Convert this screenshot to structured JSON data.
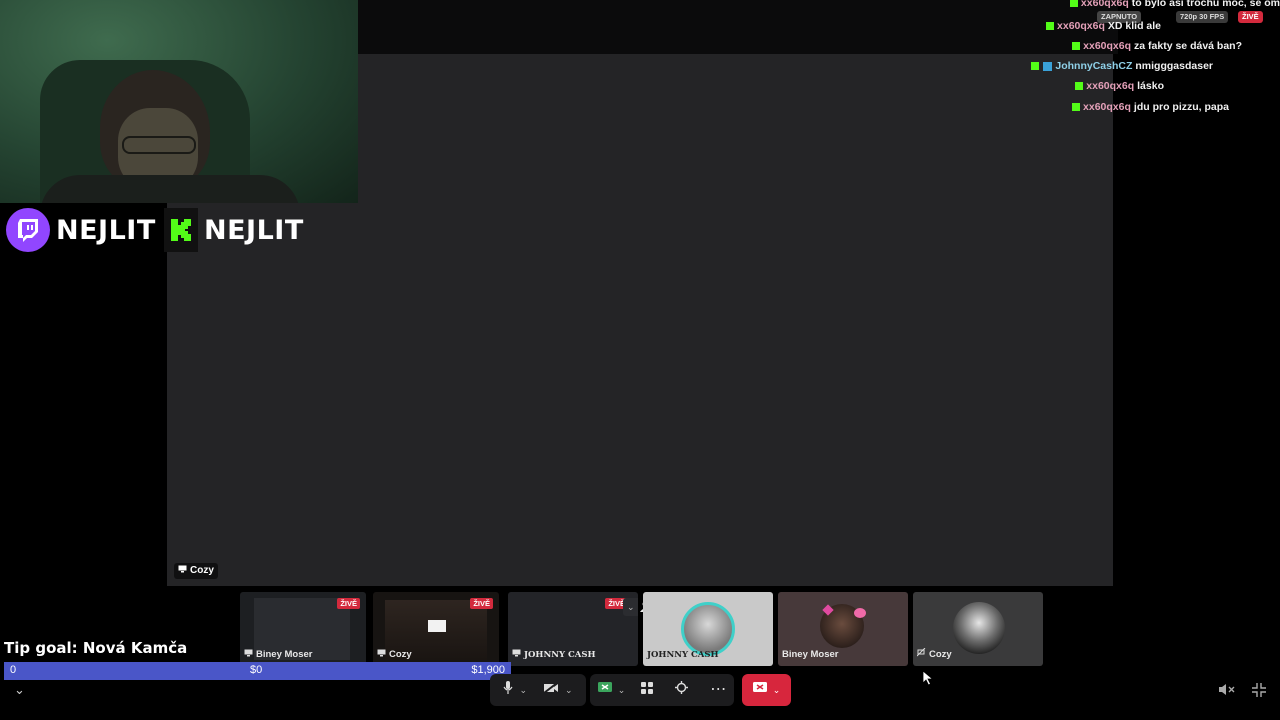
{
  "brand": {
    "twitch_name": "NEJLIT",
    "kick_name": "NEJLIT"
  },
  "status": {
    "enabled": "ZAPNUTO",
    "quality": "720p 30 FPS",
    "live": "ŽIVĚ"
  },
  "chat": [
    {
      "user": "xx60qx6q",
      "message": "to bylo asi trochu moc, se om",
      "alt": false
    },
    {
      "user": "xx60qx6q",
      "message": "XD klid ale",
      "alt": false
    },
    {
      "user": "xx60qx6q",
      "message": "za fakty se dává ban?",
      "alt": false
    },
    {
      "user": "JohnnyCashCZ",
      "message": "nmigggasdaser",
      "alt": true
    },
    {
      "user": "xx60qx6q",
      "message": "lásko",
      "alt": false
    },
    {
      "user": "xx60qx6q",
      "message": "jdu pro pizzu, papa",
      "alt": false
    }
  ],
  "stage": {
    "label": "Cozy"
  },
  "tiles": [
    {
      "name": "Biney Moser",
      "live": "ŽIVĚ"
    },
    {
      "name": "Cozy",
      "live": "ŽIVĚ"
    },
    {
      "name": "JOHNNY CASH",
      "live": "ŽIVĚ"
    },
    {
      "name": "JOHNNY CASH",
      "live": ""
    },
    {
      "name": "Biney Moser",
      "live": ""
    },
    {
      "name": "Cozy",
      "live": ""
    }
  ],
  "tip_goal": {
    "title": "Tip goal: Nová Kamča",
    "start": "0",
    "current": "$0",
    "target": "$1,900",
    "progress_percent": 0
  },
  "icons": {
    "mic": "microphone-icon",
    "camera": "camera-off-icon",
    "share": "screen-share-icon",
    "activities": "activities-icon",
    "effects": "effects-icon",
    "more": "more-icon",
    "leave": "leave-call-icon",
    "mute": "speaker-mute-icon",
    "exit_fullscreen": "exit-fullscreen-icon"
  },
  "colors": {
    "twitch": "#9146ff",
    "kick": "#53fc18",
    "live": "#d32a3d",
    "tipbar": "#4a56c8",
    "leave": "#d7263d"
  }
}
